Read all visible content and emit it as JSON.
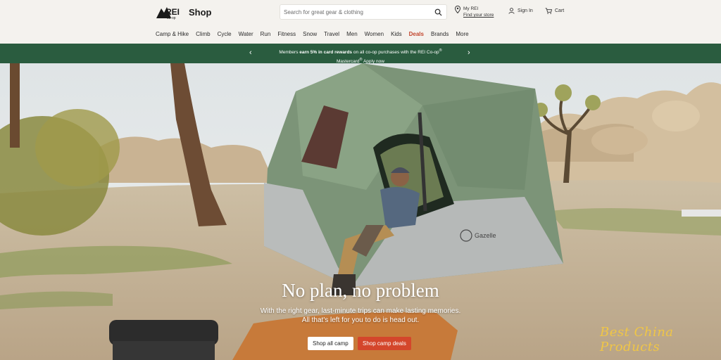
{
  "header": {
    "logo_text": "REI co-op",
    "shop_label": "Shop",
    "search_placeholder": "Search for great gear & clothing",
    "myrei_title": "My REI",
    "myrei_link": "Find your store",
    "signin_label": "Sign In",
    "cart_label": "Cart"
  },
  "nav": {
    "items": [
      "Camp & Hike",
      "Climb",
      "Cycle",
      "Water",
      "Run",
      "Fitness",
      "Snow",
      "Travel",
      "Men",
      "Women",
      "Kids",
      "Deals",
      "Brands",
      "More"
    ],
    "deals_color": "#c2452d"
  },
  "promo": {
    "prefix": "Members ",
    "bold": "earn 5% in card rewards",
    "mid": " on all co-op purchases with the REI Co-op",
    "sup": "®",
    "line2": "Mastercard",
    "sup2": "®",
    "apply": "Apply now",
    "bg_color": "#2a5c3f"
  },
  "hero": {
    "headline": "No plan, no problem",
    "subtext_line1": "With the right gear, last-minute trips can make lasting memories.",
    "subtext_line2": "All that's left for you to do is head out.",
    "cta_all": "Shop all camp",
    "cta_deals": "Shop camp deals",
    "tent_brand": "Gazelle",
    "watermark": "Best China Products"
  }
}
